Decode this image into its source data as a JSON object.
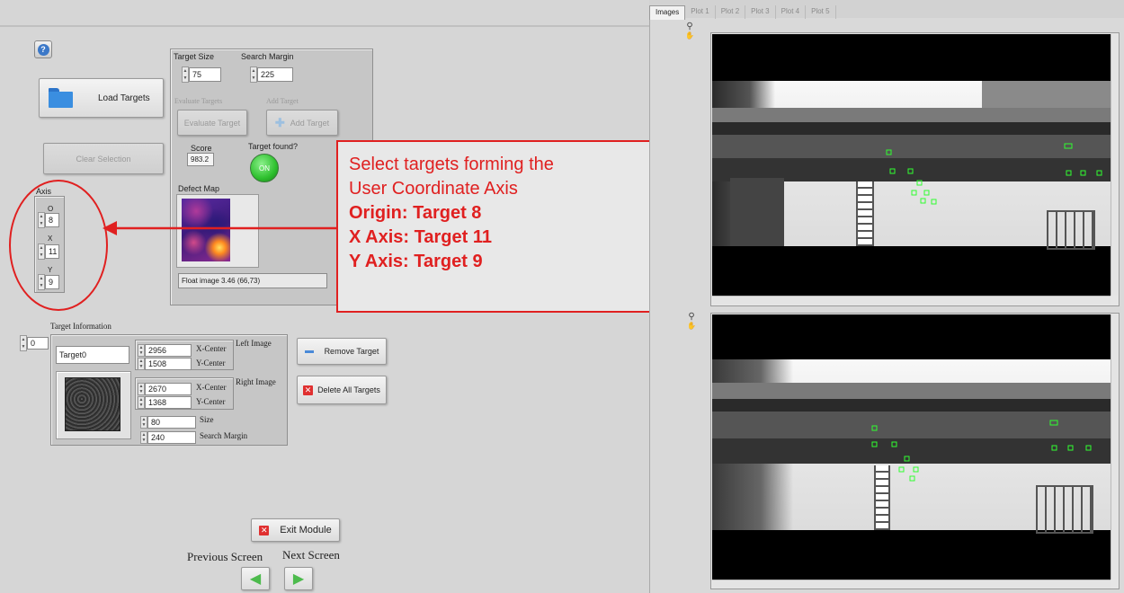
{
  "help_icon": "question-circle-icon",
  "load_targets": {
    "label": "Load Targets",
    "icon": "folder-icon"
  },
  "clear_selection": {
    "label": "Clear Selection"
  },
  "target_size": {
    "label": "Target Size",
    "value": "75"
  },
  "search_margin": {
    "label": "Search Margin",
    "value": "225"
  },
  "evaluate": {
    "caption": "Evaluate Targets",
    "label": "Evaluate Target"
  },
  "add_target": {
    "caption": "Add Target",
    "label": "Add Target",
    "icon": "plus-icon"
  },
  "score": {
    "label": "Score",
    "value": "983.2"
  },
  "target_found": {
    "label": "Target found?",
    "value": "ON"
  },
  "defect_map": {
    "label": "Defect Map",
    "status": "Float image 3.46   (66,73)"
  },
  "axis": {
    "label": "Axis",
    "o_label": "O",
    "o_value": "8",
    "x_label": "X",
    "x_value": "11",
    "y_label": "Y",
    "y_value": "9"
  },
  "callout": {
    "line1": "Select targets forming the",
    "line2": "User Coordinate Axis",
    "line3": "Origin: Target 8",
    "line4": "X Axis: Target 11",
    "line5": "Y Axis: Target 9"
  },
  "target_info": {
    "label": "Target Information",
    "index": "0",
    "name": "Target0",
    "left_image_label": "Left Image",
    "left_x": "2956",
    "left_y": "1508",
    "right_image_label": "Right Image",
    "right_x": "2670",
    "right_y": "1368",
    "x_center_label": "X-Center",
    "y_center_label": "Y-Center",
    "size_label": "Size",
    "size": "80",
    "margin_label": "Search Margin",
    "margin": "240"
  },
  "remove_target": {
    "label": "Remove Target"
  },
  "delete_all": {
    "label": "Delete All Targets"
  },
  "exit_module": {
    "label": "Exit Module"
  },
  "nav": {
    "prev": "Previous Screen",
    "next": "Next Screen"
  },
  "tabs": [
    "Images",
    "Plot 1",
    "Plot 2",
    "Plot 3",
    "Plot 4",
    "Plot 5"
  ],
  "colors": {
    "accent_red": "#e02020",
    "target_green": "#30ff30",
    "led_green": "#2ec02e"
  }
}
